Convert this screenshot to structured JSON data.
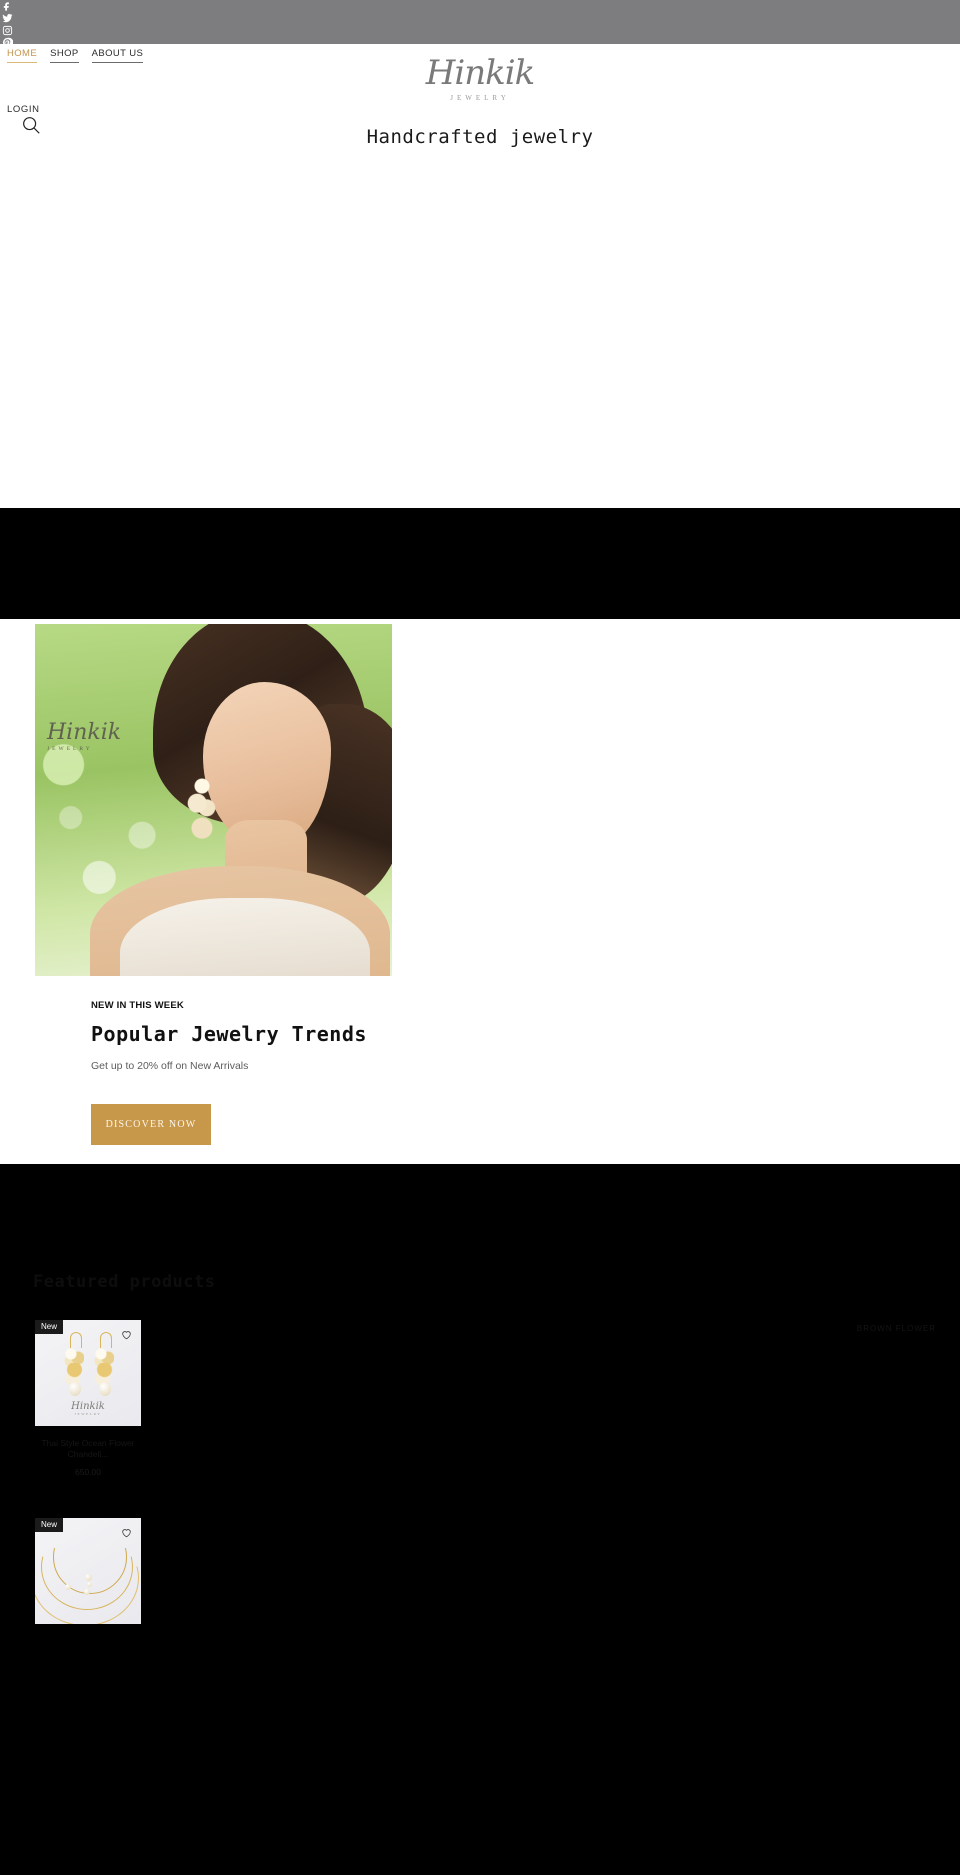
{
  "topbar": {
    "social": [
      {
        "name": "facebook-icon",
        "label": "Facebook"
      },
      {
        "name": "twitter-icon",
        "label": "Twitter"
      },
      {
        "name": "instagram-icon",
        "label": "Instagram"
      },
      {
        "name": "pinterest-icon",
        "label": "Pinterest"
      }
    ]
  },
  "nav": {
    "items": [
      {
        "label": "HOME",
        "active": true
      },
      {
        "label": "SHOP",
        "active": false
      },
      {
        "label": "ABOUT US",
        "active": false
      }
    ],
    "login_label": "LOGIN",
    "search_icon": "search-icon"
  },
  "brand": {
    "name": "Hinkik",
    "sub": "JEWELRY"
  },
  "hero": {
    "tagline": "Handcrafted jewelry"
  },
  "new_in_week": {
    "eyebrow": "NEW IN THIS WEEK",
    "title": "Popular Jewelry Trends",
    "subtitle": "Get up to 20% off on New Arrivals",
    "cta_label": "DISCOVER NOW",
    "cta_color": "#c8984a",
    "photo_overlay_brand": "Hinkik",
    "photo_overlay_sub": "JEWELRY"
  },
  "featured": {
    "title": "Featured products",
    "filter_label": "BROWN FLOWER",
    "products": [
      {
        "badge": "New",
        "name": "Thai Style Ocean Flower Chandeli...",
        "price": "650.00",
        "wish_icon": "heart-icon",
        "thumb_brand": "Hinkik",
        "thumb_sub": "JEWELRY",
        "art": "earrings"
      },
      {
        "badge": "New",
        "name": "",
        "price": "",
        "wish_icon": "heart-icon",
        "thumb_brand": "",
        "thumb_sub": "",
        "art": "necklace"
      }
    ]
  }
}
